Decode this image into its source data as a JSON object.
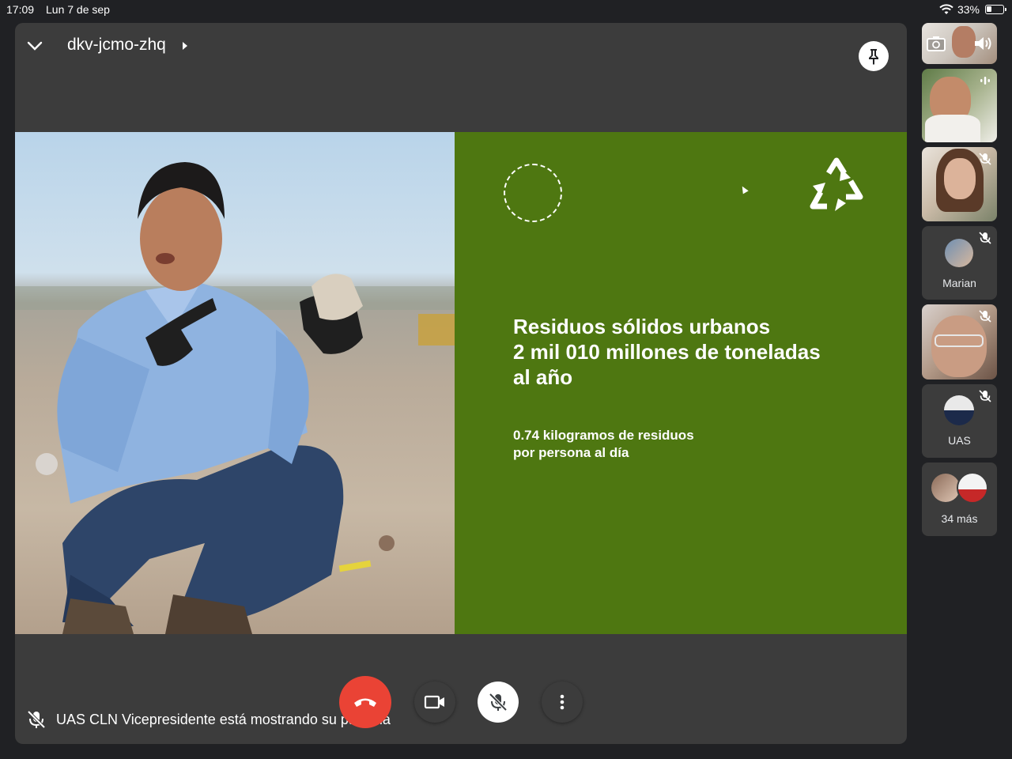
{
  "status_bar": {
    "time": "17:09",
    "date": "Lun 7 de sep",
    "battery_text": "33%",
    "battery_level": 0.33
  },
  "meeting": {
    "code": "dkv-jcmo-zhq",
    "presenter_note": "UAS CLN Vicepresidente está mostrando su pantalla"
  },
  "slide": {
    "headline_lines": [
      "Residuos sólidos urbanos",
      "2 mil 010 millones de toneladas",
      "al año"
    ],
    "sub_lines": [
      "0.74 kilogramos de residuos",
      "por persona al día"
    ],
    "background_color": "#4e7711"
  },
  "participants": [
    {
      "id": "self",
      "type": "video",
      "icons": [
        "camera-flip-icon",
        "speaker-icon"
      ]
    },
    {
      "id": "p2",
      "type": "video",
      "speaking": true
    },
    {
      "id": "p3",
      "type": "video",
      "muted": true
    },
    {
      "id": "p4",
      "type": "avatar",
      "name": "Marian",
      "muted": true
    },
    {
      "id": "p5",
      "type": "video",
      "muted": true
    },
    {
      "id": "p6",
      "type": "avatar",
      "name": "UAS",
      "muted": true
    },
    {
      "id": "more",
      "type": "more",
      "name": "34 más"
    }
  ],
  "controls": [
    "end-call",
    "camera",
    "mic-muted",
    "more-options"
  ],
  "colors": {
    "end_call": "#ea4335",
    "panel": "#3c3c3c",
    "background": "#202124"
  }
}
